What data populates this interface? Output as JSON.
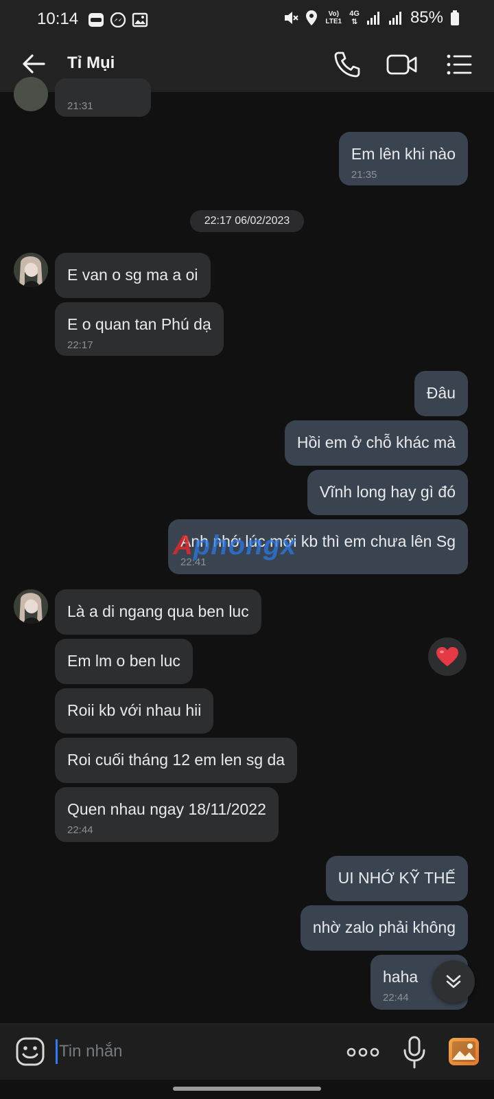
{
  "status_bar": {
    "time": "10:14",
    "left_icons": [
      "zalo-icon",
      "messenger-icon",
      "gallery-icon"
    ],
    "right_icons": [
      "mute-icon",
      "location-icon",
      "volte-icon",
      "4g-icon",
      "signal-icon",
      "signal-icon",
      "battery-icon"
    ],
    "volte_label": "Vo) LTE1",
    "network_label": "4G",
    "battery": "85%"
  },
  "header": {
    "contact_name": "Tỉ Mụi",
    "actions": [
      "back-arrow-icon",
      "phone-icon",
      "video-call-icon",
      "list-menu-icon"
    ]
  },
  "chat": {
    "date_separator": "22:17 06/02/2023",
    "messages": [
      {
        "side": "in",
        "text": "",
        "time": "21:31"
      },
      {
        "side": "out",
        "text": "Em lên khi nào",
        "time": "21:35"
      },
      {
        "side": "in",
        "text": "E van o sg ma a oi",
        "time": ""
      },
      {
        "side": "in",
        "text": "E o quan tan Phú dạ",
        "time": "22:17"
      },
      {
        "side": "out",
        "text": "Đâu",
        "time": ""
      },
      {
        "side": "out",
        "text": "Hồi em ở chỗ khác mà",
        "time": ""
      },
      {
        "side": "out",
        "text": "Vĩnh long hay gì đó",
        "time": ""
      },
      {
        "side": "out",
        "text": "Anh nhớ lúc mới kb thì em chưa lên Sg",
        "time": "22:41"
      },
      {
        "side": "in",
        "text": "Là a di ngang qua ben luc",
        "time": ""
      },
      {
        "side": "in",
        "text": "Em lm o ben luc",
        "time": ""
      },
      {
        "side": "in",
        "text": "Roii kb với nhau hii",
        "time": ""
      },
      {
        "side": "in",
        "text": "Roi cuối tháng 12 em len sg da",
        "time": ""
      },
      {
        "side": "in",
        "text": "Quen nhau ngay 18/11/2022",
        "time": "22:44"
      },
      {
        "side": "out",
        "text": "UI NHỚ KỸ THẾ",
        "time": ""
      },
      {
        "side": "out",
        "text": "nhờ zalo phải không",
        "time": ""
      },
      {
        "side": "out",
        "text": "haha",
        "time": "22:44"
      }
    ],
    "reaction": "heart-icon",
    "watermark": {
      "part1": "A",
      "part2": "phongx"
    }
  },
  "input": {
    "placeholder": "Tin nhắn",
    "value": "",
    "buttons": [
      "emoji-icon",
      "more-dots-icon",
      "microphone-icon",
      "gallery-icon"
    ]
  },
  "colors": {
    "background": "#111112",
    "bar": "#222222",
    "incoming_bubble": "#2d2e30",
    "outgoing_bubble": "#3a4450",
    "timestamp": "#8c9197",
    "heart": "#e53946",
    "cursor": "#2f7df6"
  }
}
